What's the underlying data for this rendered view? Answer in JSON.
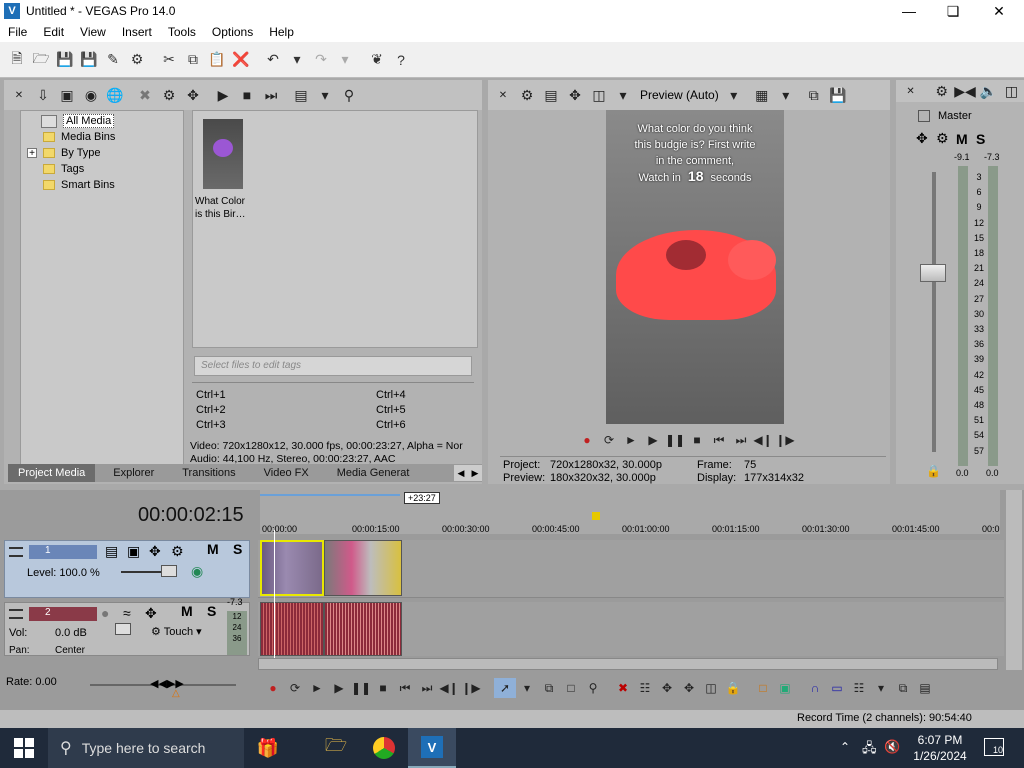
{
  "window": {
    "title": "Untitled * - VEGAS Pro 14.0",
    "app_icon": "vegas-logo-icon"
  },
  "menu": [
    "File",
    "Edit",
    "View",
    "Insert",
    "Tools",
    "Options",
    "Help"
  ],
  "explorer": {
    "tree": [
      {
        "label": "All Media",
        "selected": true
      },
      {
        "label": "Media Bins"
      },
      {
        "label": "By Type",
        "expander": "+"
      },
      {
        "label": "Tags"
      },
      {
        "label": "Smart Bins"
      }
    ],
    "media": [
      {
        "caption_line1": "What Color",
        "caption_line2": "is this Bir…"
      }
    ],
    "tags_placeholder": "Select files to edit tags",
    "shortcuts": [
      "Ctrl+1",
      "Ctrl+2",
      "Ctrl+3",
      "Ctrl+4",
      "Ctrl+5",
      "Ctrl+6"
    ],
    "info_video": "Video: 720x1280x12, 30.000 fps, 00:00:23:27, Alpha = Nor",
    "info_audio": "Audio: 44,100 Hz, Stereo, 00:00:23:27, AAC",
    "tabs": [
      "Project Media",
      "Explorer",
      "Transitions",
      "Video FX",
      "Media Generat"
    ]
  },
  "preview": {
    "mode": "Preview (Auto)",
    "overlay_lines": [
      "What color do you think",
      "this budgie is? First write",
      "in the comment,"
    ],
    "overlay_watch": "Watch in",
    "overlay_num": "18",
    "overlay_seconds": "seconds",
    "project_label": "Project:",
    "project_value": "720x1280x32, 30.000p",
    "preview_label": "Preview:",
    "preview_value": "180x320x32, 30.000p",
    "frame_label": "Frame:",
    "frame_value": "75",
    "display_label": "Display:",
    "display_value": "177x314x32"
  },
  "mixer": {
    "label": "Master",
    "m": "M",
    "s": "S",
    "peak_left": "-9.1",
    "peak_right": "-7.3",
    "scale": [
      "3",
      "6",
      "9",
      "12",
      "15",
      "18",
      "21",
      "24",
      "27",
      "30",
      "33",
      "36",
      "39",
      "42",
      "45",
      "48",
      "51",
      "54",
      "57"
    ],
    "bottom_left": "0.0",
    "bottom_right": "0.0"
  },
  "timeline": {
    "timecode": "00:00:02:15",
    "region_badge": "+23:27",
    "ruler": [
      "00:00:00",
      "00:00:15:00",
      "00:00:30:00",
      "00:00:45:00",
      "00:01:00:00",
      "00:01:15:00",
      "00:01:30:00",
      "00:01:45:00",
      "00:0"
    ],
    "track1": {
      "num": "1",
      "m": "M",
      "s": "S",
      "level": "Level: 100.0 %"
    },
    "track2": {
      "num": "2",
      "m": "M",
      "s": "S",
      "vol_label": "Vol:",
      "vol_value": "0.0 dB",
      "touch": "Touch",
      "pan_label": "Pan:",
      "pan_value": "Center",
      "meter": "-7.3",
      "meter_scale": [
        "12",
        "24",
        "36"
      ]
    },
    "rate": "Rate: 0.00"
  },
  "status": {
    "record_time": "Record Time (2 channels): 90:54:40"
  },
  "taskbar": {
    "search_placeholder": "Type here to search",
    "time": "6:07 PM",
    "date": "1/26/2024",
    "notifications": "10"
  }
}
